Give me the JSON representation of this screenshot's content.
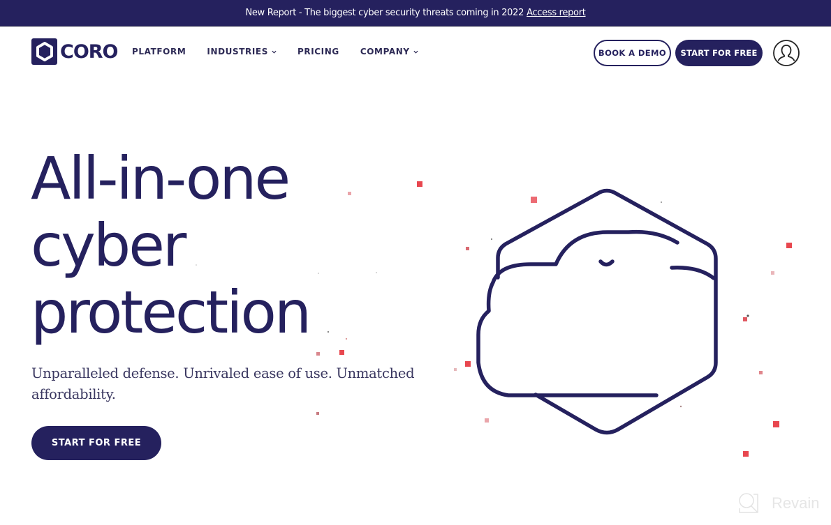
{
  "banner": {
    "text": "New Report - The biggest cyber security threats coming in 2022",
    "link_label": "Access report"
  },
  "brand": {
    "name": "CORO",
    "logo_icon": "hexagon-logo-icon",
    "primary_color": "#25215e",
    "accent_color": "#e8474f"
  },
  "nav": {
    "items": [
      {
        "label": "PLATFORM",
        "has_dropdown": false
      },
      {
        "label": "INDUSTRIES",
        "has_dropdown": true
      },
      {
        "label": "PRICING",
        "has_dropdown": false
      },
      {
        "label": "COMPANY",
        "has_dropdown": true
      }
    ],
    "book_demo_label": "BOOK A DEMO",
    "start_free_label": "START FOR FREE",
    "user_icon": "user-account-icon"
  },
  "hero": {
    "title_lines": [
      "All-in-one",
      "cyber",
      "protection"
    ],
    "subtitle": "Unparalleled defense. Unrivaled ease of use. Unmatched affordability.",
    "cta_label": "START FOR FREE",
    "illustration": "cloud-in-hexagon-illustration"
  },
  "watermark": {
    "text": "Revain"
  }
}
